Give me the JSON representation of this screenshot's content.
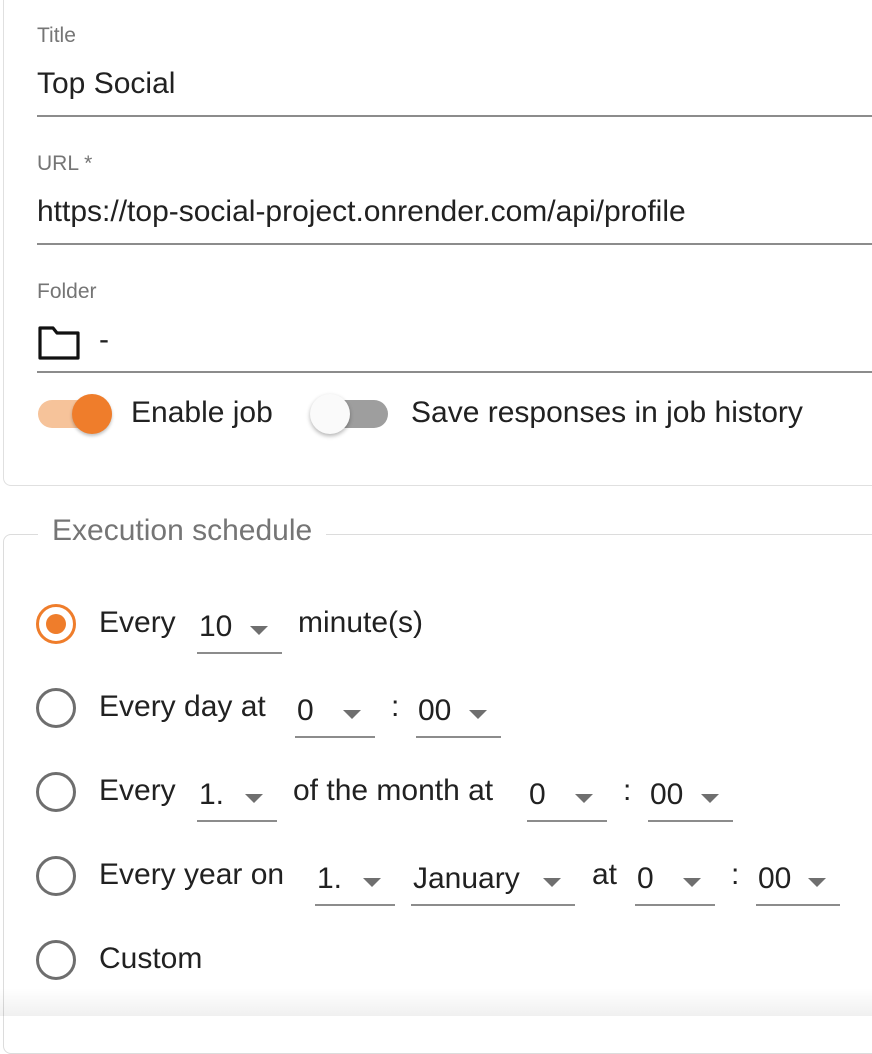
{
  "form": {
    "title": {
      "label": "Title",
      "value": "Top Social"
    },
    "url": {
      "label": "URL *",
      "value": "https://top-social-project.onrender.com/api/profile"
    },
    "folder": {
      "label": "Folder",
      "icon": "folder-icon",
      "value": "-"
    },
    "enable_job": {
      "label": "Enable job",
      "on": true
    },
    "save_responses": {
      "label": "Save responses in job history",
      "on": false
    }
  },
  "schedule": {
    "legend": "Execution schedule",
    "accent_color": "#ef7d2b",
    "selected": "every_minutes",
    "every_minutes": {
      "prefix": "Every",
      "interval": "10",
      "suffix": "minute(s)"
    },
    "every_day": {
      "prefix": "Every day at",
      "hour": "0",
      "separator": ":",
      "minute": "00"
    },
    "every_month": {
      "prefix": "Every",
      "day": "1.",
      "middle": "of the month at",
      "hour": "0",
      "separator": ":",
      "minute": "00"
    },
    "every_year": {
      "prefix": "Every year on",
      "day": "1.",
      "month": "January",
      "middle": "at",
      "hour": "0",
      "separator": ":",
      "minute": "00"
    },
    "custom": {
      "label": "Custom"
    }
  }
}
